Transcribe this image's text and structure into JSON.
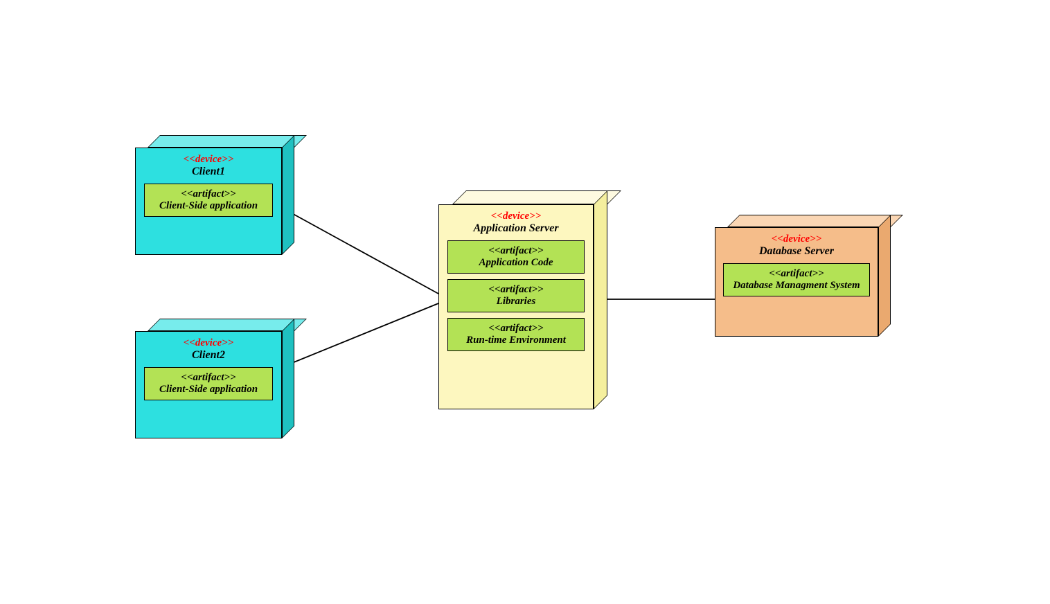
{
  "labels": {
    "device": "<<device>>",
    "artifact": "<<artifact>>"
  },
  "nodes": {
    "client1": {
      "title": "Client1",
      "artifacts": [
        "Client-Side application"
      ]
    },
    "client2": {
      "title": "Client2",
      "artifacts": [
        "Client-Side application"
      ]
    },
    "appserver": {
      "title": "Application Server",
      "artifacts": [
        "Application Code",
        "Libraries",
        "Run-time Environment"
      ]
    },
    "dbserver": {
      "title": "Database Server",
      "artifacts": [
        "Database Managment System"
      ]
    }
  },
  "edges": [
    {
      "from": "client1",
      "to": "appserver"
    },
    {
      "from": "client2",
      "to": "appserver"
    },
    {
      "from": "appserver",
      "to": "dbserver"
    }
  ]
}
